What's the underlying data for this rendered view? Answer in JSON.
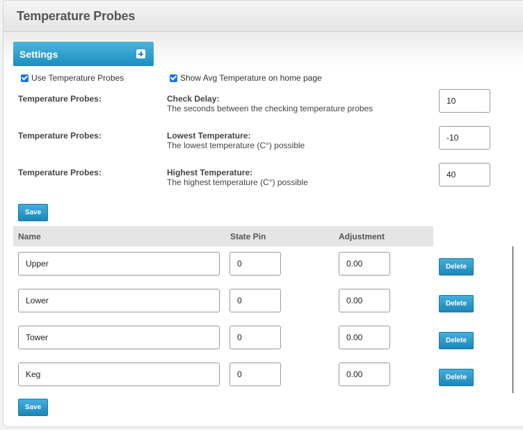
{
  "header": {
    "title": "Temperature Probes"
  },
  "settings": {
    "tab_label": "Settings",
    "expand_icon": "plus-icon",
    "checkboxes": [
      {
        "label": "Use Temperature Probes",
        "checked": true
      },
      {
        "label": "Show Avg Temperature on home page",
        "checked": true
      }
    ],
    "rows": [
      {
        "key": "Temperature Probes:",
        "name": "Check Delay:",
        "desc": "The seconds between the checking temperature probes",
        "value": "10"
      },
      {
        "key": "Temperature Probes:",
        "name": "Lowest Temperature:",
        "desc": "The lowest temperature (C°) possible",
        "value": "-10"
      },
      {
        "key": "Temperature Probes:",
        "name": "Highest Temperature:",
        "desc": "The highest temperature (C°) possible",
        "value": "40"
      }
    ],
    "save_label": "Save"
  },
  "probes": {
    "columns": [
      "Name",
      "State Pin",
      "Adjustment"
    ],
    "rows": [
      {
        "name": "Upper",
        "pin": "0",
        "adjustment": "0.00"
      },
      {
        "name": "Lower",
        "pin": "0",
        "adjustment": "0.00"
      },
      {
        "name": "Tower",
        "pin": "0",
        "adjustment": "0.00"
      },
      {
        "name": "Keg",
        "pin": "0",
        "adjustment": "0.00"
      }
    ],
    "delete_label": "Delete",
    "save_label": "Save"
  },
  "colors": {
    "accent": "#1a8ec0",
    "checkbox": "#1a73e8"
  }
}
